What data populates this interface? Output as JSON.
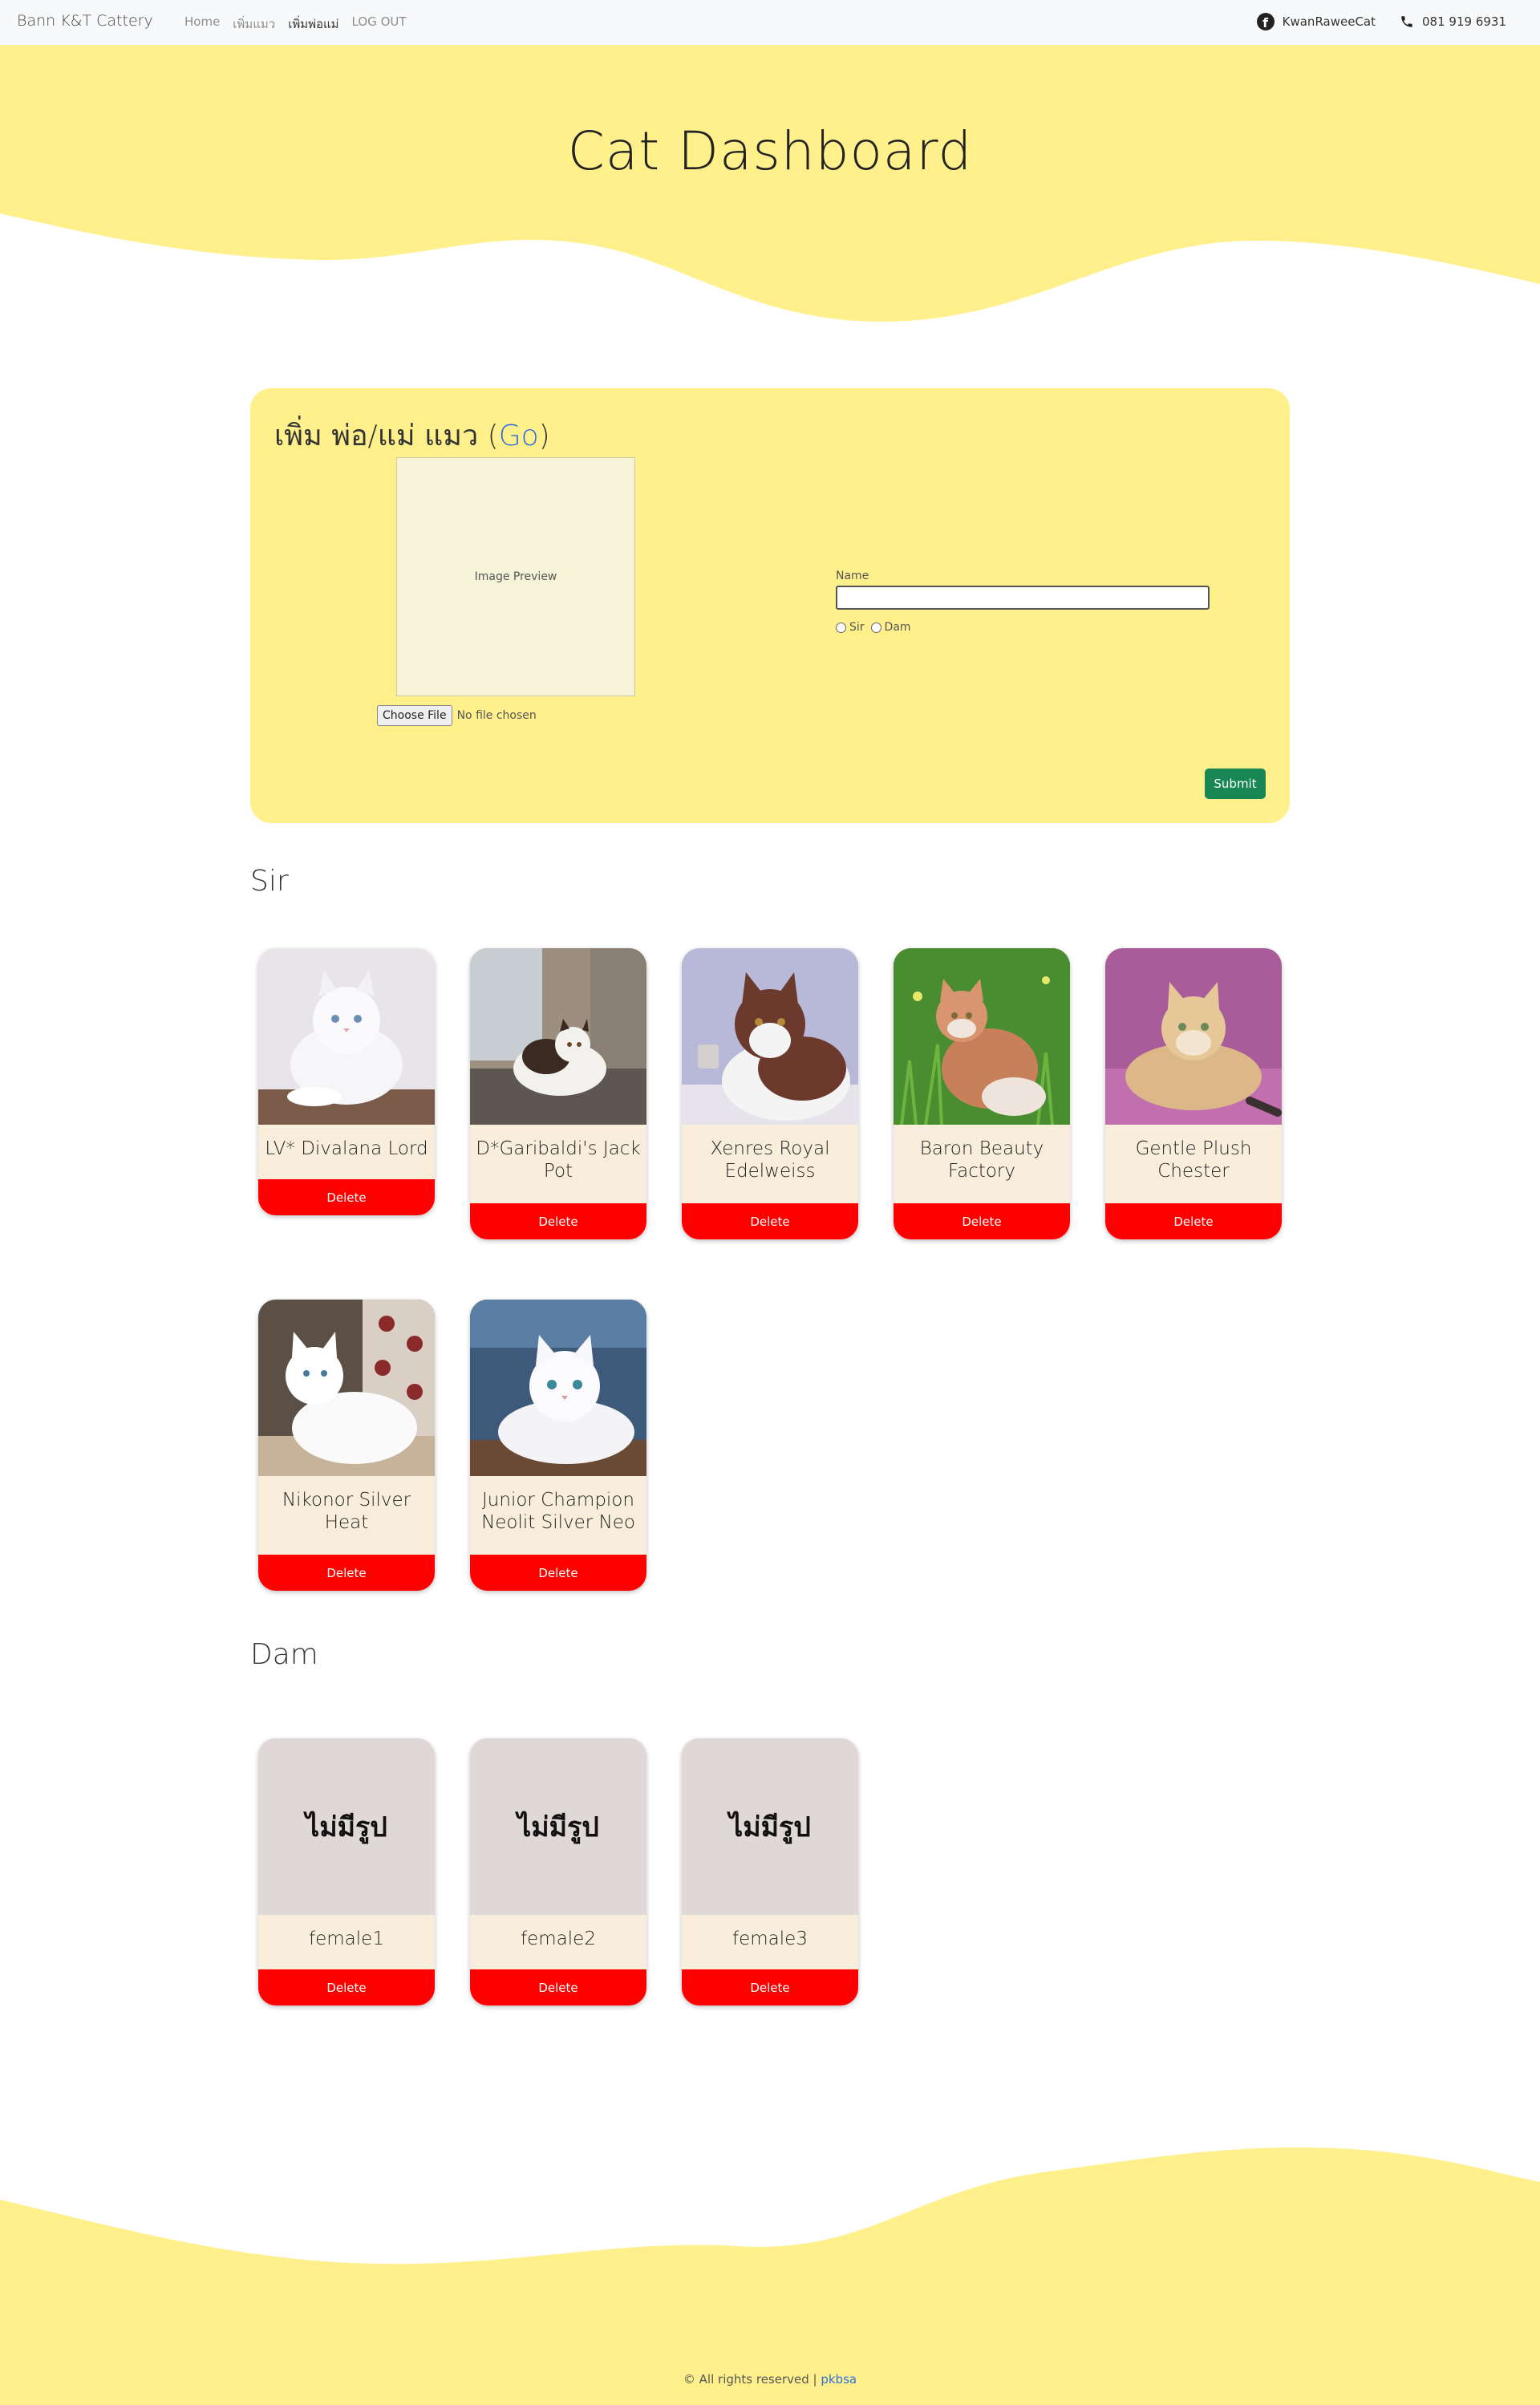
{
  "navbar": {
    "brand": "Bann K&T Cattery",
    "links": [
      {
        "label": "Home"
      },
      {
        "label": "เพิ่มแมว"
      },
      {
        "label": "เพิ่มพ่อแม่"
      },
      {
        "label": "LOG OUT"
      }
    ],
    "facebook": "KwanRaweeCat",
    "phone": "081 919 6931"
  },
  "hero": {
    "title": "Cat Dashboard"
  },
  "form": {
    "title_prefix": "เพิ่ม พ่อ/แม่ แมว (",
    "title_link": "Go",
    "title_suffix": ")",
    "image_preview": "Image Preview",
    "choose_file": "Choose File",
    "no_file": "No file chosen",
    "name_label": "Name",
    "name_value": "",
    "radio_sir": "Sir",
    "radio_dam": "Dam",
    "submit": "Submit"
  },
  "sir": {
    "title": "Sir",
    "cats": [
      {
        "name": "LV* Divalana Lord",
        "delete": "Delete"
      },
      {
        "name": "D*Garibaldi's Jack Pot",
        "delete": "Delete"
      },
      {
        "name": "Xenres Royal Edelweiss",
        "delete": "Delete"
      },
      {
        "name": "Baron Beauty Factory",
        "delete": "Delete"
      },
      {
        "name": "Gentle Plush Chester",
        "delete": "Delete"
      },
      {
        "name": "Nikonor Silver Heat",
        "delete": "Delete"
      },
      {
        "name": "Junior Champion Neolit Silver Neo",
        "delete": "Delete"
      }
    ]
  },
  "dam": {
    "title": "Dam",
    "cats": [
      {
        "name": "female1",
        "placeholder": "ไม่มีรูป",
        "delete": "Delete"
      },
      {
        "name": "female2",
        "placeholder": "ไม่มีรูป",
        "delete": "Delete"
      },
      {
        "name": "female3",
        "placeholder": "ไม่มีรูป",
        "delete": "Delete"
      }
    ]
  },
  "footer": {
    "text": "© All rights reserved | ",
    "link": "pkbsa"
  }
}
